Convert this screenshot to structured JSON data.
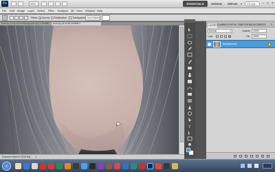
{
  "appbar": {
    "logo": "Ps",
    "zoom": "33%",
    "workspaces": [
      "ESSENTIALS",
      "DESIGN",
      "ZEPLIN"
    ],
    "search": "CS Live"
  },
  "menu": [
    "File",
    "Edit",
    "Image",
    "Layer",
    "Select",
    "Filter",
    "Analysis",
    "3D",
    "View",
    "Window",
    "Help"
  ],
  "options": {
    "patch": "Patch:",
    "source": "Source",
    "destination": "Destination",
    "transparent": "Transparent",
    "use_pattern": "Use Pattern"
  },
  "tabs": [
    "Retouch.psd @ 16.7% (Background copy 2, RGB/8) *",
    "photo.jpg @ 33.3% (RGB/8*) *"
  ],
  "status": "Exposure works in 32-bit only",
  "layers_panel": {
    "tabs": [
      "LAYERS",
      "CHANNELS",
      "PATHS",
      "SWATCHES",
      "ADJUSTMENTS"
    ],
    "blend_mode": "Normal",
    "opacity_label": "Opacity:",
    "opacity_value": "100%",
    "lock_label": "Lock:",
    "fill_label": "Fill:",
    "fill_value": "100%",
    "layer_name": "Background"
  },
  "colors": {
    "accent": "#3d92d8",
    "selected_layer": "#4e9bdb"
  }
}
